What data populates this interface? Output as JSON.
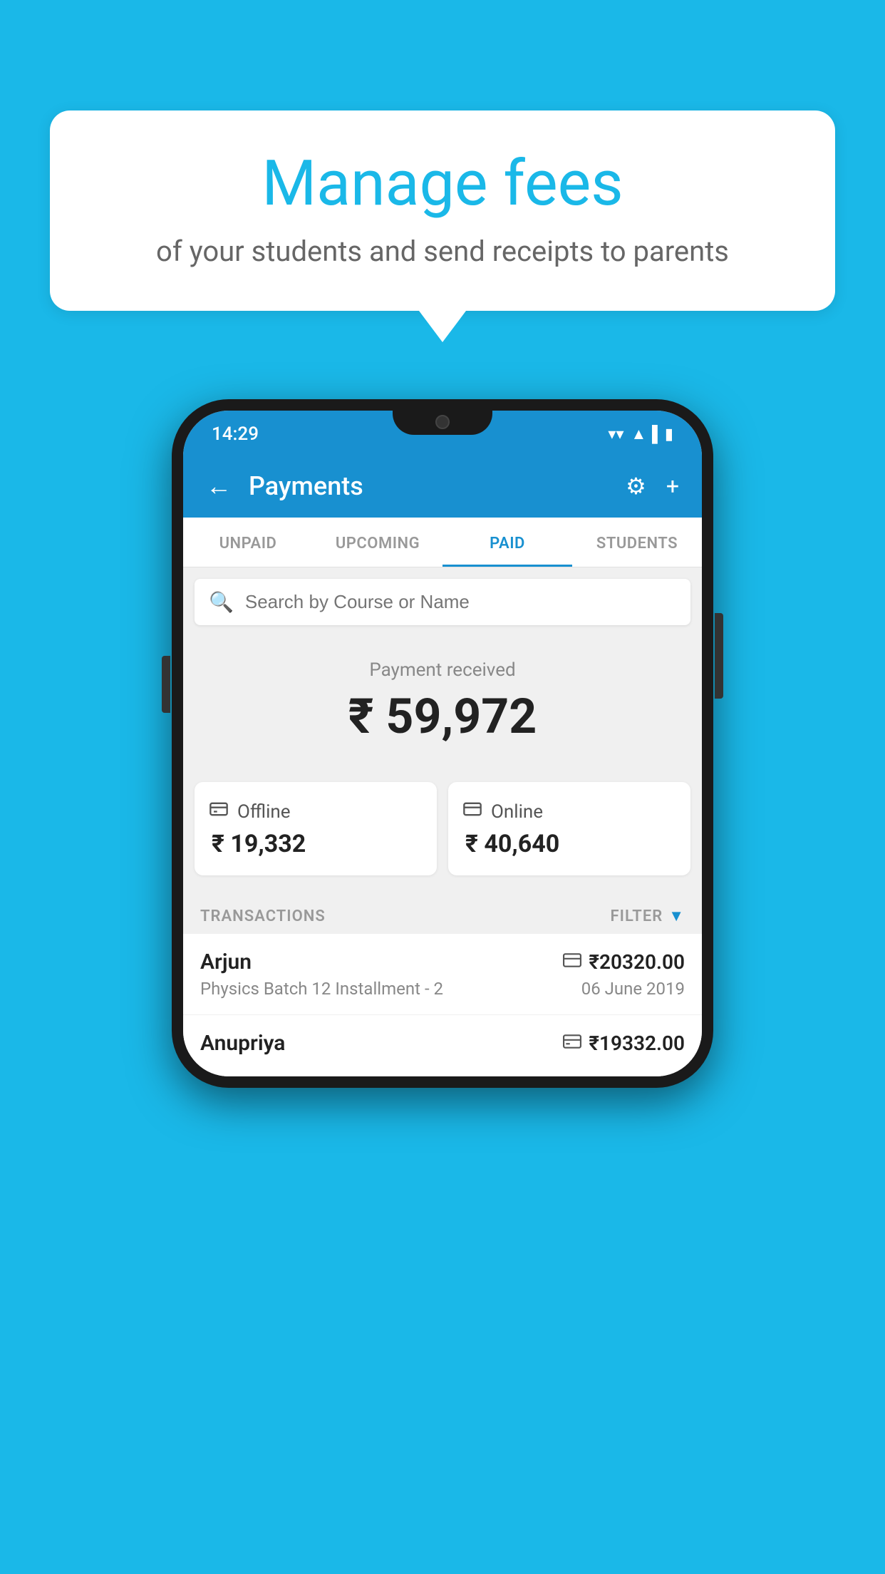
{
  "page": {
    "background_color": "#1ab8e8"
  },
  "speech_bubble": {
    "title": "Manage fees",
    "subtitle": "of your students and send receipts to parents"
  },
  "status_bar": {
    "time": "14:29",
    "wifi": "▼",
    "signal": "◀",
    "battery": "▮"
  },
  "header": {
    "title": "Payments",
    "back_label": "←",
    "settings_icon": "⚙",
    "add_icon": "+"
  },
  "tabs": [
    {
      "label": "UNPAID",
      "active": false
    },
    {
      "label": "UPCOMING",
      "active": false
    },
    {
      "label": "PAID",
      "active": true
    },
    {
      "label": "STUDENTS",
      "active": false
    }
  ],
  "search": {
    "placeholder": "Search by Course or Name"
  },
  "payment_summary": {
    "label": "Payment received",
    "amount": "₹ 59,972",
    "offline_label": "Offline",
    "offline_amount": "₹ 19,332",
    "online_label": "Online",
    "online_amount": "₹ 40,640"
  },
  "transactions": {
    "header_label": "TRANSACTIONS",
    "filter_label": "FILTER",
    "items": [
      {
        "name": "Arjun",
        "course": "Physics Batch 12 Installment - 2",
        "amount": "₹20320.00",
        "date": "06 June 2019",
        "type": "online"
      },
      {
        "name": "Anupriya",
        "course": "",
        "amount": "₹19332.00",
        "date": "",
        "type": "offline"
      }
    ]
  }
}
